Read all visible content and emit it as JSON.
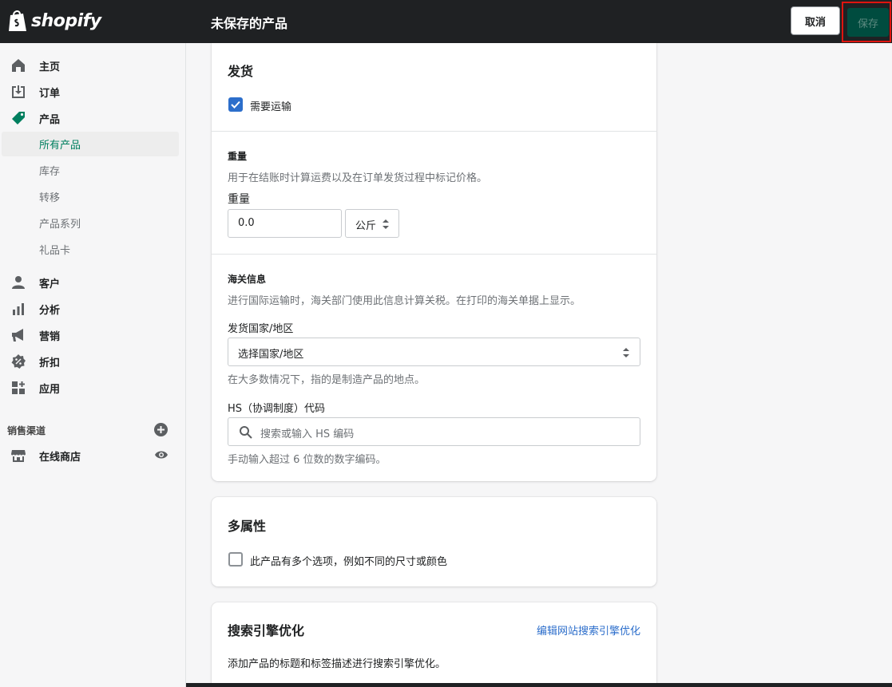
{
  "topbar": {
    "logo_text": "shopify",
    "title": "未保存的产品",
    "cancel_label": "取消",
    "save_label": "保存"
  },
  "sidebar": {
    "items": [
      {
        "label": "主页",
        "icon": "home-icon"
      },
      {
        "label": "订单",
        "icon": "orders-icon"
      },
      {
        "label": "产品",
        "icon": "tag-icon"
      }
    ],
    "product_sub": [
      {
        "label": "所有产品",
        "active": true
      },
      {
        "label": "库存"
      },
      {
        "label": "转移"
      },
      {
        "label": "产品系列"
      },
      {
        "label": "礼品卡"
      }
    ],
    "items2": [
      {
        "label": "客户",
        "icon": "customer-icon"
      },
      {
        "label": "分析",
        "icon": "analytics-icon"
      },
      {
        "label": "营销",
        "icon": "megaphone-icon"
      },
      {
        "label": "折扣",
        "icon": "discount-icon"
      },
      {
        "label": "应用",
        "icon": "apps-icon"
      }
    ],
    "channels_heading": "销售渠道",
    "online_store": "在线商店"
  },
  "shipping": {
    "title": "发货",
    "requires_shipping_label": "需要运输",
    "requires_shipping_checked": true,
    "weight_heading": "重量",
    "weight_help": "用于在结账时计算运费以及在订单发货过程中标记价格。",
    "weight_label": "重量",
    "weight_value": "0.0",
    "weight_unit": "公斤",
    "customs_heading": "海关信息",
    "customs_help": "进行国际运输时，海关部门使用此信息计算关税。在打印的海关单据上显示。",
    "country_label": "发货国家/地区",
    "country_value": "选择国家/地区",
    "country_help": "在大多数情况下，指的是制造产品的地点。",
    "hs_label": "HS（协调制度）代码",
    "hs_placeholder": "搜索或输入 HS 编码",
    "hs_help": "手动输入超过 6 位数的数字编码。"
  },
  "variants": {
    "title": "多属性",
    "option_label": "此产品有多个选项，例如不同的尺寸或颜色",
    "option_checked": false
  },
  "seo": {
    "title": "搜索引擎优化",
    "edit_link": "编辑网站搜索引擎优化",
    "description": "添加产品的标题和标签描述进行搜索引擎优化。"
  },
  "colors": {
    "topbar": "#1f2123",
    "accent_green": "#007f5f",
    "save_bg": "#004c3f",
    "checkbox_blue": "#2c6ecb",
    "link_blue": "#2c6ecb",
    "highlight_red": "#e0140f"
  }
}
